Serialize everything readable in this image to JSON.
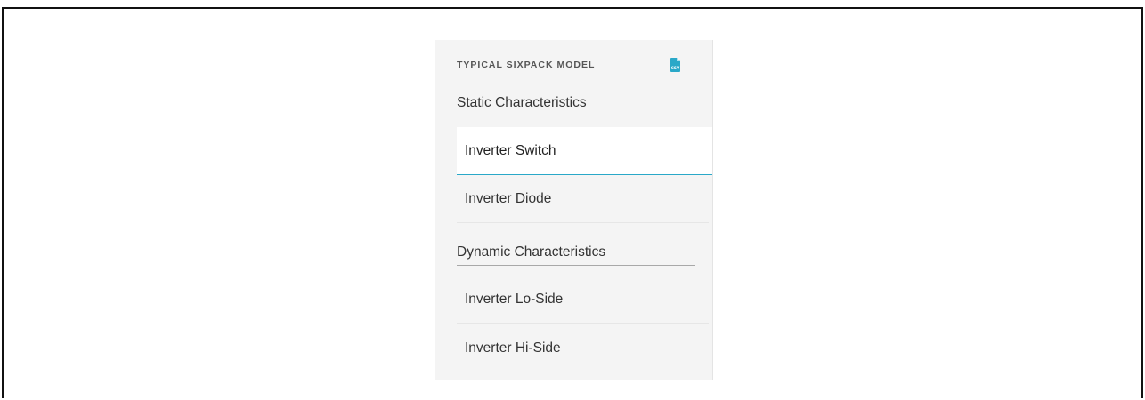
{
  "panel": {
    "title": "TYPICAL SIXPACK MODEL",
    "download_icon": "csv-file-icon",
    "accent_color": "#2aa8c8",
    "sections": [
      {
        "heading": "Static Characteristics",
        "items": [
          {
            "label": "Inverter Switch",
            "selected": true
          },
          {
            "label": "Inverter Diode",
            "selected": false
          }
        ]
      },
      {
        "heading": "Dynamic Characteristics",
        "items": [
          {
            "label": "Inverter Lo-Side",
            "selected": false
          },
          {
            "label": "Inverter Hi-Side",
            "selected": false
          }
        ]
      }
    ]
  }
}
